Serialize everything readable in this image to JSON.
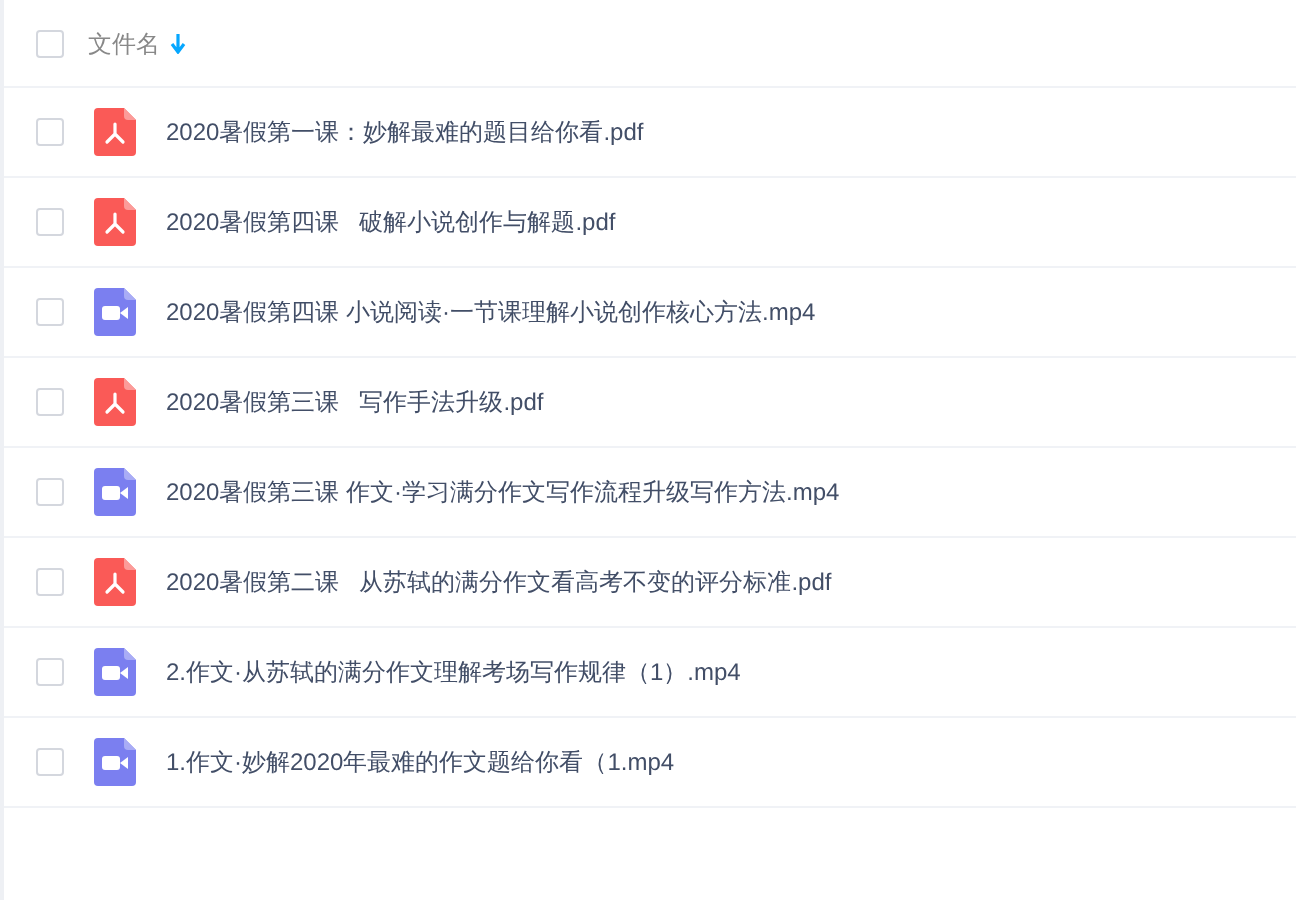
{
  "header": {
    "checked": false,
    "label": "文件名"
  },
  "files": [
    {
      "kind": "pdf",
      "checked": false,
      "name": "2020暑假第一课：妙解最难的题目给你看.pdf"
    },
    {
      "kind": "pdf",
      "checked": false,
      "name": "2020暑假第四课   破解小说创作与解题.pdf"
    },
    {
      "kind": "video",
      "checked": false,
      "name": "2020暑假第四课 小说阅读·一节课理解小说创作核心方法.mp4"
    },
    {
      "kind": "pdf",
      "checked": false,
      "name": "2020暑假第三课   写作手法升级.pdf"
    },
    {
      "kind": "video",
      "checked": false,
      "name": "2020暑假第三课 作文·学习满分作文写作流程升级写作方法.mp4"
    },
    {
      "kind": "pdf",
      "checked": false,
      "name": "2020暑假第二课   从苏轼的满分作文看高考不变的评分标准.pdf"
    },
    {
      "kind": "video",
      "checked": false,
      "name": "2.作文·从苏轼的满分作文理解考场写作规律（1）.mp4"
    },
    {
      "kind": "video",
      "checked": false,
      "name": "1.作文·妙解2020年最难的作文题给你看（1.mp4"
    }
  ]
}
